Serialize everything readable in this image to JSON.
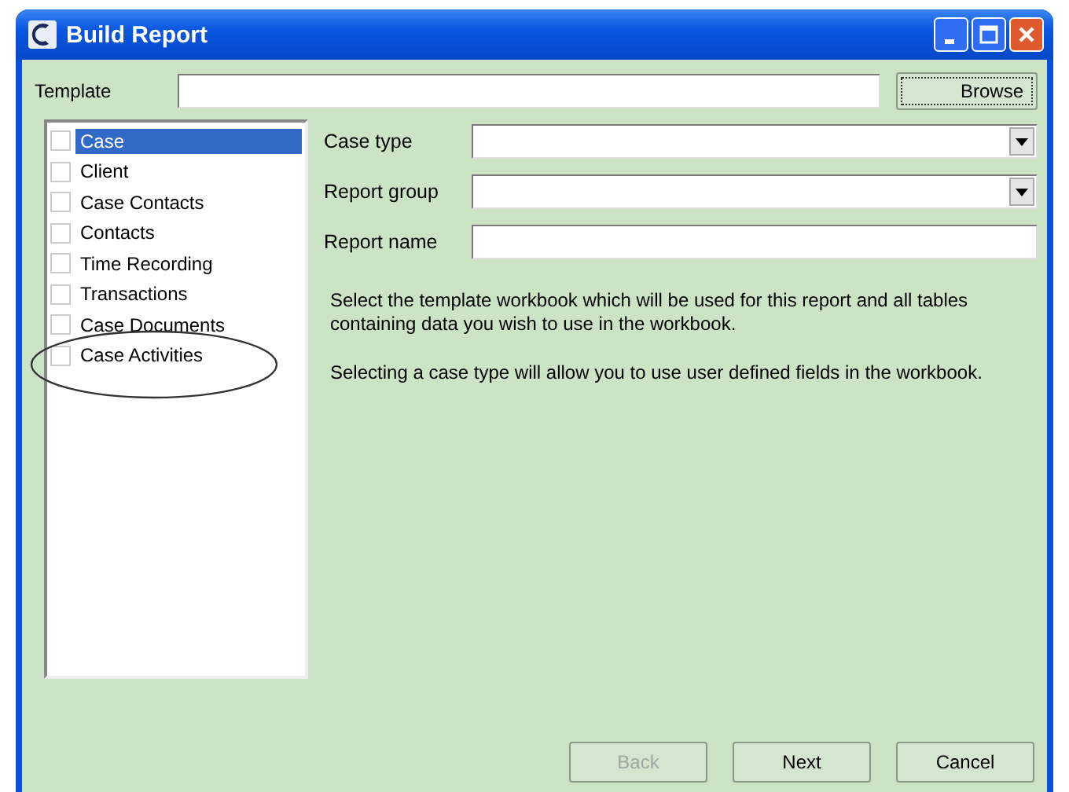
{
  "window": {
    "title": "Build Report"
  },
  "template": {
    "label": "Template",
    "button": "Browse"
  },
  "tables": [
    {
      "label": "Case",
      "checked": false,
      "selected": true
    },
    {
      "label": "Client",
      "checked": false,
      "selected": false
    },
    {
      "label": "Case Contacts",
      "checked": false,
      "selected": false
    },
    {
      "label": "Contacts",
      "checked": false,
      "selected": false
    },
    {
      "label": "Time Recording",
      "checked": false,
      "selected": false
    },
    {
      "label": "Transactions",
      "checked": false,
      "selected": false
    },
    {
      "label": "Case Documents",
      "checked": false,
      "selected": false
    },
    {
      "label": "Case Activities",
      "checked": false,
      "selected": false
    }
  ],
  "fields": [
    {
      "kind": "dropdown",
      "label": "Case type"
    },
    {
      "kind": "dropdown",
      "label": "Report group"
    },
    {
      "kind": "text",
      "label": "Report name"
    }
  ],
  "help": [
    "Select the template workbook which will be used for this report and all tables containing data you wish to use in the workbook.",
    "Selecting a case type will allow you to use user defined fields in the workbook."
  ],
  "buttons": [
    {
      "label": "Back",
      "disabled": true
    },
    {
      "label": "Next",
      "disabled": false
    },
    {
      "label": "Cancel",
      "disabled": false
    }
  ]
}
